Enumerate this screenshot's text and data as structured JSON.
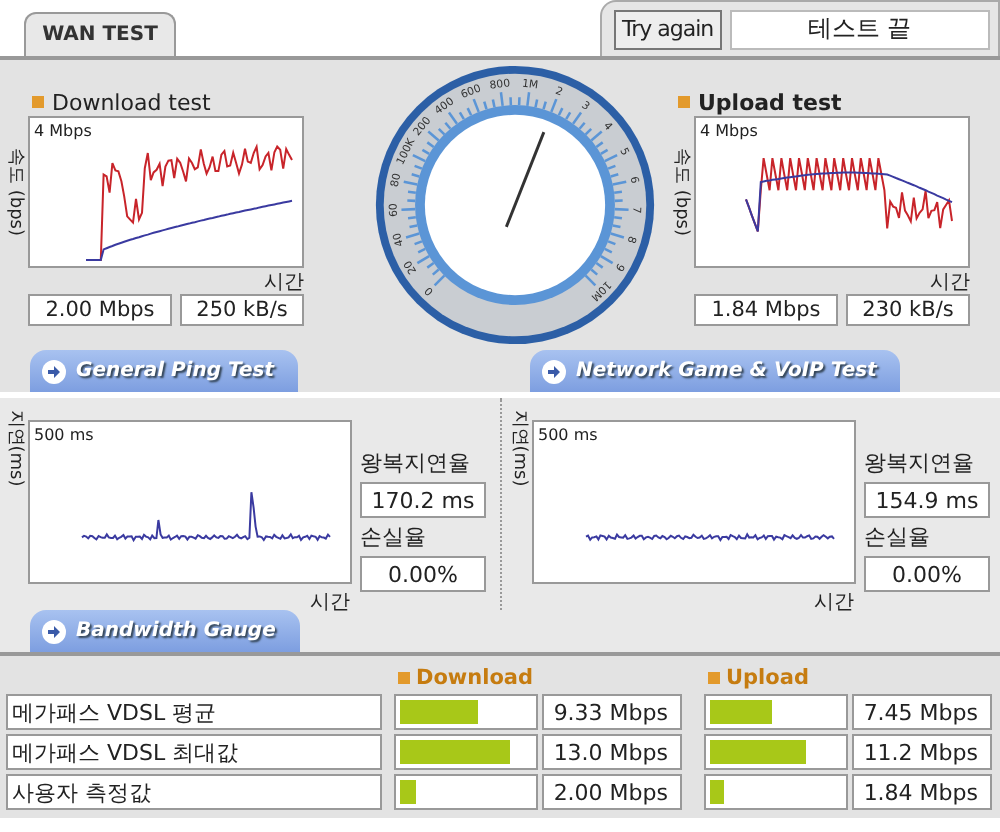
{
  "tabs": [
    {
      "label": "WAN TEST",
      "selected": true
    }
  ],
  "controls": {
    "retry_button": "Try again",
    "status": "테스트 끝"
  },
  "throughput": [
    {
      "title": "Download test",
      "ylabel": "속도 (bps)",
      "scale": "4 Mbps",
      "xlabel": "시간",
      "rate": "2.00 Mbps",
      "bytes": "250 kB/s"
    },
    {
      "title": "Upload test",
      "ylabel": "속도 (bps)",
      "scale": "4 Mbps",
      "xlabel": "시간",
      "rate": "1.84 Mbps",
      "bytes": "230 kB/s"
    }
  ],
  "gauge": {
    "labels": [
      "0",
      "20",
      "40",
      "60",
      "80",
      "100K",
      "200",
      "400",
      "600",
      "800",
      "1M",
      "2",
      "3",
      "4",
      "5",
      "6",
      "7",
      "8",
      "9",
      "10M"
    ]
  },
  "sections": [
    {
      "title": "General Ping Test"
    },
    {
      "title": "Network Game & VoIP Test"
    }
  ],
  "ping": [
    {
      "ylabel": "지연(ms)",
      "scale": "500 ms",
      "xlabel": "시간",
      "latency_label": "왕복지연율",
      "latency": "170.2 ms",
      "loss_label": "손실율",
      "loss": "0.00%"
    },
    {
      "ylabel": "지연(ms)",
      "scale": "500 ms",
      "xlabel": "시간",
      "latency_label": "왕복지연율",
      "latency": "154.9 ms",
      "loss_label": "손실율",
      "loss": "0.00%"
    }
  ],
  "bandwidth": {
    "title": "Bandwidth Gauge",
    "columns": [
      "Download",
      "Upload"
    ],
    "rows": [
      {
        "label": "메가패스 VDSL 평균",
        "download": {
          "level": 0.59,
          "value": "9.33 Mbps"
        },
        "upload": {
          "level": 0.47,
          "value": "7.45 Mbps"
        }
      },
      {
        "label": "메가패스 VDSL 최대값",
        "download": {
          "level": 0.83,
          "value": "13.0 Mbps"
        },
        "upload": {
          "level": 0.73,
          "value": "11.2 Mbps"
        }
      },
      {
        "label": "사용자 측정값",
        "download": {
          "level": 0.12,
          "value": "2.00 Mbps"
        },
        "upload": {
          "level": 0.11,
          "value": "1.84 Mbps"
        }
      }
    ]
  }
}
